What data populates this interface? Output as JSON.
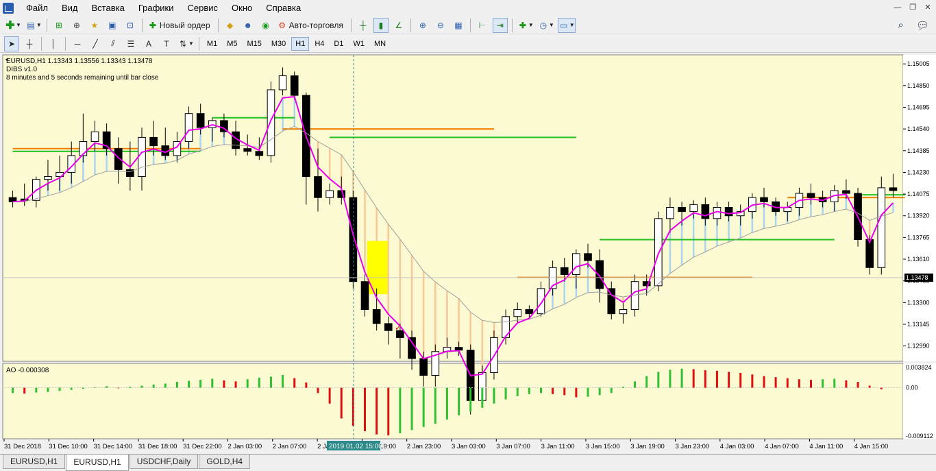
{
  "menu": [
    "Файл",
    "Вид",
    "Вставка",
    "Графики",
    "Сервис",
    "Окно",
    "Справка"
  ],
  "toolbar": {
    "new_order": "Новый ордер",
    "autotrading": "Авто-торговля"
  },
  "timeframes": [
    "M1",
    "M5",
    "M15",
    "M30",
    "H1",
    "H4",
    "D1",
    "W1",
    "MN"
  ],
  "active_timeframe": "H1",
  "chart": {
    "header": "EURUSD,H1  1.13343 1.13556 1.13343 1.13478",
    "indicator_name": "DIBS v1.0",
    "timer_text": "8 minutes and 5 seconds remaining until bar close",
    "current_price_label": "1.13478",
    "price_ticks": [
      "1.15005",
      "1.14850",
      "1.14695",
      "1.14540",
      "1.14385",
      "1.14230",
      "1.14075",
      "1.13920",
      "1.13765",
      "1.13610",
      "1.13455",
      "1.13300",
      "1.13145",
      "1.12990"
    ],
    "time_ticks": [
      "31 Dec 2018",
      "31 Dec 10:00",
      "31 Dec 14:00",
      "31 Dec 18:00",
      "31 Dec 22:00",
      "2 Jan 03:00",
      "2 Jan 07:00",
      "2 Jan",
      "2 Jan 19:00",
      "2 Jan 23:00",
      "3 Jan 03:00",
      "3 Jan 07:00",
      "3 Jan 11:00",
      "3 Jan 15:00",
      "3 Jan 19:00",
      "3 Jan 23:00",
      "4 Jan 03:00",
      "4 Jan 07:00",
      "4 Jan 11:00",
      "4 Jan 15:00"
    ],
    "crosshair_time_label": "2019.01.02 15:00",
    "ao_label": "AO -0.000308",
    "ao_ticks": [
      "0.003824",
      "0.00",
      "-0.009112"
    ],
    "colors": {
      "background": "#fbfad2",
      "bull": "#ffffff",
      "bear": "#000000",
      "ma_fast": "#e800e8",
      "green_level": "#20c020",
      "orange_level": "#f08000",
      "ao_up": "#30c030",
      "ao_down": "#e01010",
      "highlight": "#ffff00"
    }
  },
  "chart_data": {
    "type": "candlestick",
    "symbol": "EURUSD",
    "timeframe": "H1",
    "ylim": [
      1.129,
      1.1505
    ],
    "candles": [
      [
        1.1405,
        1.141,
        1.1398,
        1.1402
      ],
      [
        1.1404,
        1.1415,
        1.1399,
        1.1403
      ],
      [
        1.1403,
        1.142,
        1.1398,
        1.1418
      ],
      [
        1.1418,
        1.1432,
        1.141,
        1.142
      ],
      [
        1.142,
        1.1435,
        1.141,
        1.1423
      ],
      [
        1.1423,
        1.1445,
        1.1415,
        1.1435
      ],
      [
        1.1435,
        1.1465,
        1.143,
        1.1445
      ],
      [
        1.1445,
        1.146,
        1.1438,
        1.1452
      ],
      [
        1.1452,
        1.1458,
        1.1435,
        1.144
      ],
      [
        1.144,
        1.1448,
        1.1415,
        1.1425
      ],
      [
        1.1425,
        1.1445,
        1.141,
        1.142
      ],
      [
        1.142,
        1.1455,
        1.141,
        1.1448
      ],
      [
        1.1448,
        1.146,
        1.1435,
        1.1442
      ],
      [
        1.1442,
        1.1455,
        1.1432,
        1.1435
      ],
      [
        1.1435,
        1.1452,
        1.143,
        1.1445
      ],
      [
        1.1445,
        1.147,
        1.144,
        1.1465
      ],
      [
        1.1465,
        1.1472,
        1.145,
        1.1455
      ],
      [
        1.1455,
        1.1462,
        1.1445,
        1.146
      ],
      [
        1.146,
        1.1465,
        1.1448,
        1.1452
      ],
      [
        1.1452,
        1.146,
        1.1435,
        1.144
      ],
      [
        1.144,
        1.145,
        1.1435,
        1.1438
      ],
      [
        1.1438,
        1.1448,
        1.1432,
        1.1435
      ],
      [
        1.1435,
        1.1488,
        1.143,
        1.1482
      ],
      [
        1.1482,
        1.1498,
        1.1478,
        1.1492
      ],
      [
        1.1492,
        1.1495,
        1.1475,
        1.1478
      ],
      [
        1.1478,
        1.148,
        1.14,
        1.142
      ],
      [
        1.142,
        1.144,
        1.1395,
        1.1405
      ],
      [
        1.1405,
        1.1415,
        1.14,
        1.141
      ],
      [
        1.141,
        1.142,
        1.14,
        1.1405
      ],
      [
        1.1405,
        1.141,
        1.134,
        1.1345
      ],
      [
        1.1345,
        1.135,
        1.132,
        1.1325
      ],
      [
        1.1325,
        1.134,
        1.131,
        1.1315
      ],
      [
        1.1315,
        1.132,
        1.13,
        1.131
      ],
      [
        1.131,
        1.1315,
        1.129,
        1.1305
      ],
      [
        1.1305,
        1.131,
        1.1282,
        1.129
      ],
      [
        1.129,
        1.1295,
        1.127,
        1.1278
      ],
      [
        1.1278,
        1.13,
        1.127,
        1.1295
      ],
      [
        1.1295,
        1.1305,
        1.129,
        1.1298
      ],
      [
        1.1298,
        1.1302,
        1.1292,
        1.1296
      ],
      [
        1.1296,
        1.13,
        1.125,
        1.126
      ],
      [
        1.126,
        1.1285,
        1.1255,
        1.128
      ],
      [
        1.128,
        1.131,
        1.1275,
        1.1305
      ],
      [
        1.1305,
        1.1325,
        1.13,
        1.132
      ],
      [
        1.132,
        1.133,
        1.1315,
        1.1325
      ],
      [
        1.1325,
        1.1328,
        1.1318,
        1.1322
      ],
      [
        1.1322,
        1.1345,
        1.132,
        1.134
      ],
      [
        1.134,
        1.136,
        1.1335,
        1.1355
      ],
      [
        1.1355,
        1.1362,
        1.1345,
        1.135
      ],
      [
        1.135,
        1.1368,
        1.134,
        1.1365
      ],
      [
        1.1365,
        1.1372,
        1.1355,
        1.136
      ],
      [
        1.136,
        1.1368,
        1.133,
        1.134
      ],
      [
        1.134,
        1.1345,
        1.1318,
        1.1322
      ],
      [
        1.1322,
        1.133,
        1.1315,
        1.1325
      ],
      [
        1.1325,
        1.135,
        1.132,
        1.1345
      ],
      [
        1.1345,
        1.135,
        1.1335,
        1.1342
      ],
      [
        1.1342,
        1.1395,
        1.1338,
        1.139
      ],
      [
        1.139,
        1.1405,
        1.138,
        1.1398
      ],
      [
        1.1398,
        1.1402,
        1.1385,
        1.1395
      ],
      [
        1.1395,
        1.1403,
        1.139,
        1.14
      ],
      [
        1.14,
        1.1405,
        1.1385,
        1.139
      ],
      [
        1.139,
        1.1402,
        1.1385,
        1.1398
      ],
      [
        1.1398,
        1.1402,
        1.1388,
        1.1392
      ],
      [
        1.1392,
        1.14,
        1.1385,
        1.1395
      ],
      [
        1.1395,
        1.1408,
        1.139,
        1.1405
      ],
      [
        1.1405,
        1.1412,
        1.1398,
        1.1402
      ],
      [
        1.1402,
        1.1405,
        1.1392,
        1.1395
      ],
      [
        1.1395,
        1.1402,
        1.1388,
        1.1398
      ],
      [
        1.1398,
        1.1412,
        1.1392,
        1.1408
      ],
      [
        1.1408,
        1.1415,
        1.14,
        1.1405
      ],
      [
        1.1405,
        1.141,
        1.1398,
        1.1402
      ],
      [
        1.1402,
        1.1414,
        1.1395,
        1.141
      ],
      [
        1.141,
        1.1418,
        1.1404,
        1.1408
      ],
      [
        1.1408,
        1.1412,
        1.137,
        1.1375
      ],
      [
        1.1375,
        1.1378,
        1.135,
        1.1355
      ],
      [
        1.1355,
        1.142,
        1.135,
        1.1412
      ],
      [
        1.1412,
        1.1422,
        1.1405,
        1.141
      ]
    ],
    "ao": [
      -0.001,
      -0.0011,
      -0.0009,
      -0.0008,
      -0.0006,
      -0.0004,
      -0.0002,
      0.0001,
      0.0003,
      -0.0001,
      0.0002,
      0.0004,
      0.0006,
      0.0008,
      0.0011,
      0.0013,
      0.0015,
      0.0017,
      0.0014,
      0.0012,
      0.0016,
      0.0019,
      0.0021,
      0.0024,
      0.0018,
      0.001,
      -0.001,
      -0.003,
      -0.0058,
      -0.0072,
      -0.0082,
      -0.0088,
      -0.009,
      -0.0086,
      -0.008,
      -0.0074,
      -0.0068,
      -0.006,
      -0.0052,
      -0.0045,
      -0.0038,
      -0.003,
      -0.0022,
      -0.0016,
      -0.0012,
      -0.001,
      -0.0012,
      -0.0014,
      -0.0018,
      -0.0017,
      -0.0014,
      -0.001,
      0.0002,
      0.0012,
      0.0022,
      0.003,
      0.0034,
      0.0036,
      0.0035,
      0.0033,
      0.0032,
      0.003,
      0.0028,
      0.0025,
      0.0022,
      0.002,
      0.0018,
      0.0016,
      0.0015,
      0.0016,
      0.0017,
      0.0014,
      0.0011,
      0.0004,
      -0.0003
    ],
    "green_levels": [
      [
        0,
        16,
        1.1438
      ],
      [
        17,
        24,
        1.1462
      ],
      [
        27,
        48,
        1.1448
      ],
      [
        50,
        70,
        1.1375
      ],
      [
        72,
        76,
        1.1407
      ]
    ],
    "orange_levels": [
      [
        0,
        16,
        1.144
      ],
      [
        23,
        41,
        1.1454
      ],
      [
        43,
        63,
        1.1348
      ],
      [
        66,
        76,
        1.1405
      ]
    ]
  }
}
